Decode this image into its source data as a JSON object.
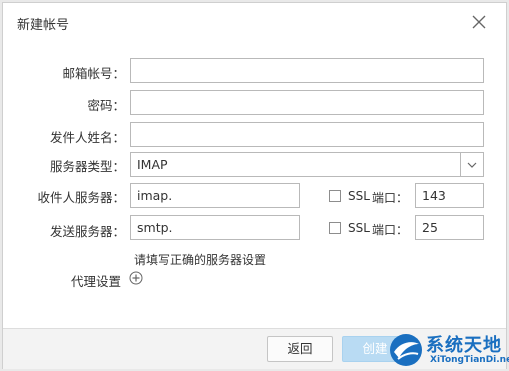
{
  "dialog": {
    "title": "新建帐号",
    "close_icon": "close-icon"
  },
  "form": {
    "email": {
      "label": "邮箱帐号：",
      "value": ""
    },
    "password": {
      "label": "密码：",
      "value": ""
    },
    "sender_name": {
      "label": "发件人姓名：",
      "value": ""
    },
    "server_type": {
      "label": "服务器类型：",
      "value": "IMAP",
      "icon": "chevron-down-icon"
    },
    "incoming": {
      "label": "收件人服务器：",
      "value": "imap.",
      "ssl_label": "SSL",
      "port_label": "端口：",
      "ssl_checked": false,
      "port": "143"
    },
    "outgoing": {
      "label": "发送服务器：",
      "value": "smtp.",
      "ssl_label": "SSL",
      "port_label": "端口：",
      "ssl_checked": false,
      "port": "25"
    },
    "hint": "请填写正确的服务器设置",
    "proxy": {
      "label": "代理设置",
      "icon": "plus-circle-icon"
    }
  },
  "footer": {
    "back_label": "返回",
    "create_label": "创建"
  },
  "watermark": {
    "title": "系统天地",
    "url": "XiTongTianDi.net",
    "colors": {
      "brand": "#1a6fc0"
    }
  }
}
